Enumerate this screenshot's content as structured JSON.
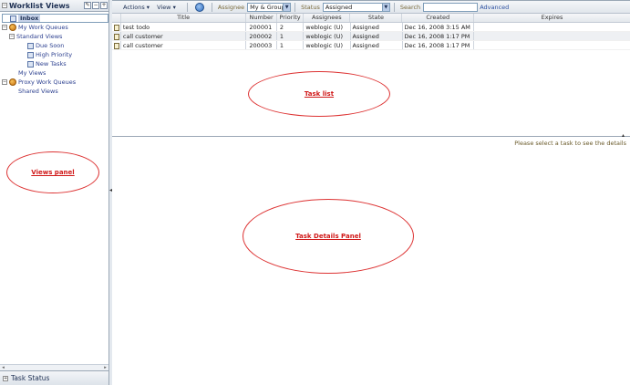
{
  "views_panel": {
    "title": "Worklist Views",
    "header_buttons": [
      "edit",
      "minus",
      "plus"
    ],
    "tree": [
      {
        "label": "Inbox",
        "level": 1,
        "icon": "view-icon",
        "selected": true
      },
      {
        "label": "My Work Queues",
        "level": 0,
        "icon": "group-icon",
        "expander": "−"
      },
      {
        "label": "Standard Views",
        "level": 1,
        "expander": "−"
      },
      {
        "label": "Due Soon",
        "level": 2,
        "icon": "view-icon"
      },
      {
        "label": "High Priority",
        "level": 2,
        "icon": "view-icon"
      },
      {
        "label": "New Tasks",
        "level": 2,
        "icon": "view-icon"
      },
      {
        "label": "My Views",
        "level": 1
      },
      {
        "label": "Proxy Work Queues",
        "level": 0,
        "icon": "group-icon",
        "expander": "−"
      },
      {
        "label": "Shared Views",
        "level": 1
      }
    ],
    "task_status_label": "Task Status"
  },
  "toolbar": {
    "actions_label": "Actions ▾",
    "view_label": "View ▾",
    "assignee_label": "Assignee",
    "assignee_value": "My & Group",
    "status_label": "Status",
    "status_value": "Assigned",
    "search_label": "Search",
    "search_value": "",
    "advanced_label": "Advanced"
  },
  "table": {
    "columns": [
      "Title",
      "Number",
      "Priority",
      "Assignees",
      "State",
      "Created",
      "Expires"
    ],
    "rows": [
      {
        "title": "test todo",
        "number": "200001",
        "priority": "2",
        "assignees": "weblogic (U)",
        "state": "Assigned",
        "created": "Dec 16, 2008 3:15 AM",
        "expires": ""
      },
      {
        "title": "call customer",
        "number": "200002",
        "priority": "1",
        "assignees": "weblogic (U)",
        "state": "Assigned",
        "created": "Dec 16, 2008 1:17 PM",
        "expires": ""
      },
      {
        "title": "call customer",
        "number": "200003",
        "priority": "1",
        "assignees": "weblogic (U)",
        "state": "Assigned",
        "created": "Dec 16, 2008 1:17 PM",
        "expires": ""
      }
    ]
  },
  "details": {
    "message": "Please select a task to see the details"
  },
  "annotations": {
    "task_list": "Task list",
    "views_panel": "Views panel",
    "task_details_panel": "Task Details Panel"
  },
  "colors": {
    "annotation": "#d01818",
    "link": "#2b3f8f",
    "selected_row": "#c6d2e8"
  }
}
